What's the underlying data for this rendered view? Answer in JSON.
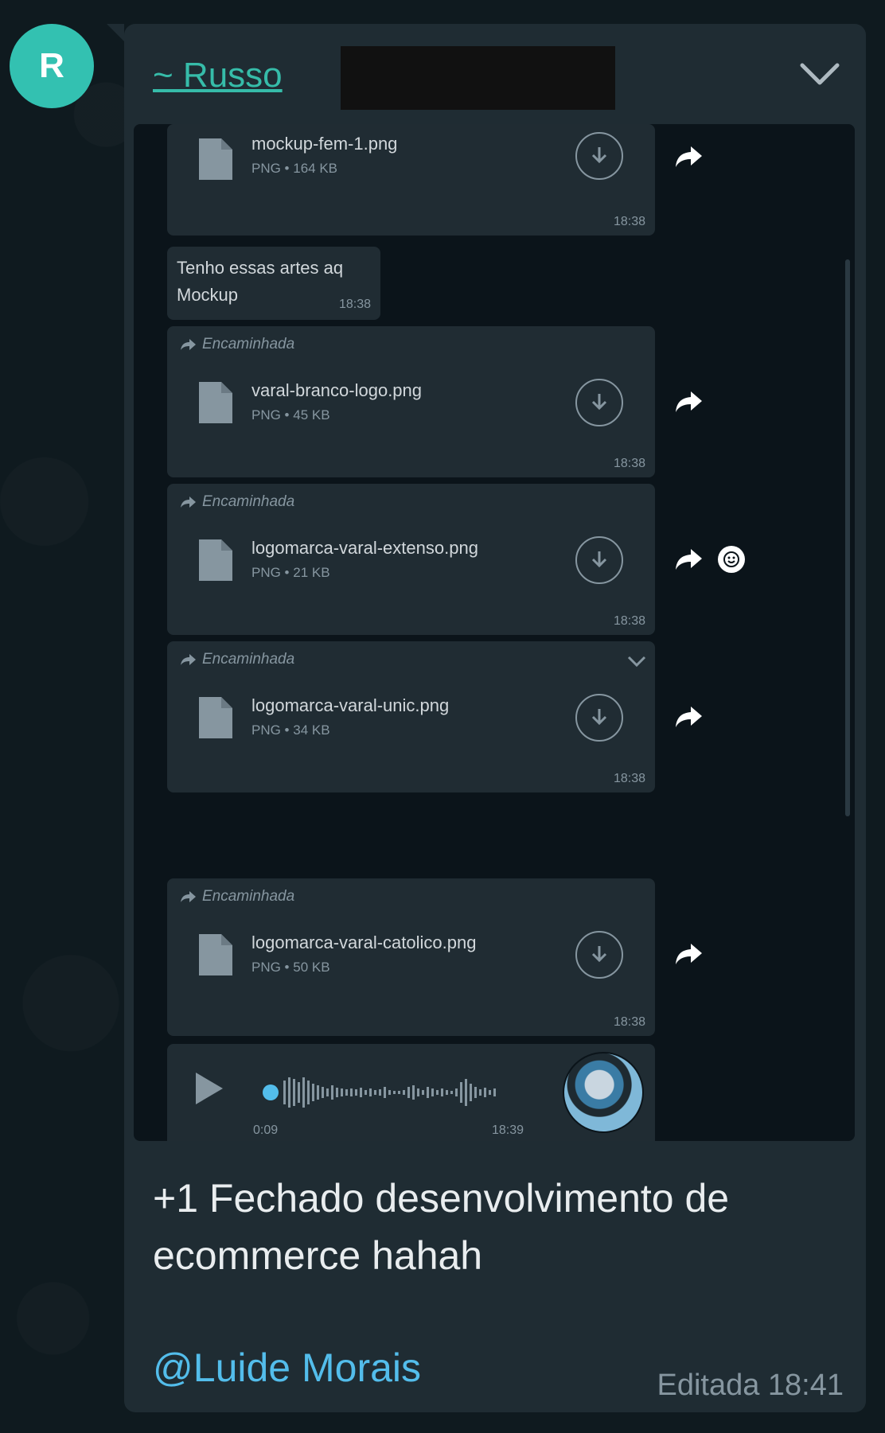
{
  "avatar": {
    "initial": "R",
    "color": "#33c1b1"
  },
  "sender": {
    "name": "~ Russo",
    "color": "#36bca9"
  },
  "quoted_messages": [
    {
      "kind": "file",
      "forwarded": false,
      "file_name": "mockup-fem-1.png",
      "meta": "PNG • 164 KB",
      "time": "18:38"
    },
    {
      "kind": "text",
      "lines": [
        "Tenho essas artes aq",
        "Mockup"
      ],
      "time": "18:38"
    },
    {
      "kind": "file",
      "forwarded": true,
      "forwarded_label": "Encaminhada",
      "file_name": "varal-branco-logo.png",
      "meta": "PNG • 45 KB",
      "time": "18:38"
    },
    {
      "kind": "file",
      "forwarded": true,
      "forwarded_label": "Encaminhada",
      "file_name": "logomarca-varal-extenso.png",
      "meta": "PNG • 21 KB",
      "time": "18:38"
    },
    {
      "kind": "file",
      "forwarded": true,
      "forwarded_label": "Encaminhada",
      "file_name": "logomarca-varal-unic.png",
      "meta": "PNG • 34 KB",
      "time": "18:38"
    },
    {
      "kind": "file",
      "forwarded": true,
      "forwarded_label": "Encaminhada",
      "file_name": "logomarca-varal-catolico.png",
      "meta": "PNG • 50 KB",
      "time": "18:38"
    }
  ],
  "audio": {
    "duration": "0:09",
    "time": "18:39",
    "progress": 0.0
  },
  "message": {
    "text_line1": "+1 Fechado desenvolvimento de",
    "text_line2": "ecommerce hahah",
    "mention": "@Luide Morais",
    "edited": "Editada 18:41"
  },
  "icons": {
    "download": "download-arrow-icon",
    "share": "forward-share-icon",
    "file": "document-icon",
    "emoji": "emoji-react-icon",
    "chevron": "chevron-down-icon",
    "play": "play-icon"
  }
}
